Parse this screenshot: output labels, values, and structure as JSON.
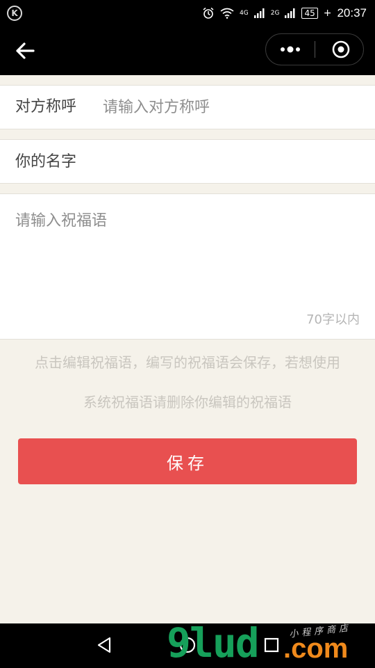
{
  "status_bar": {
    "carrier_icon": "K",
    "alarm_icon": "alarm-icon",
    "wifi_icon": "wifi-icon",
    "network_1": "4G",
    "network_2": "2G",
    "battery": "45",
    "time": "20:37"
  },
  "nav": {
    "back_icon": "arrow-left-icon",
    "more_icon": "more-dots-icon",
    "close_icon": "target-close-icon"
  },
  "form": {
    "recipient_label": "对方称呼",
    "recipient_placeholder": "请输入对方称呼",
    "name_placeholder": "你的名字",
    "greeting_placeholder": "请输入祝福语",
    "char_limit": "70字以内"
  },
  "hint": {
    "line1": "点击编辑祝福语，编写的祝福语会保存，若想使用",
    "line2": "系统祝福语请删除你编辑的祝福语"
  },
  "save_label": "保存",
  "watermark": {
    "main": "9lud",
    "dot": ".com",
    "sub": "小程序商店"
  },
  "colors": {
    "background": "#f5f2ea",
    "save_button": "#e85050",
    "header": "#000000"
  }
}
